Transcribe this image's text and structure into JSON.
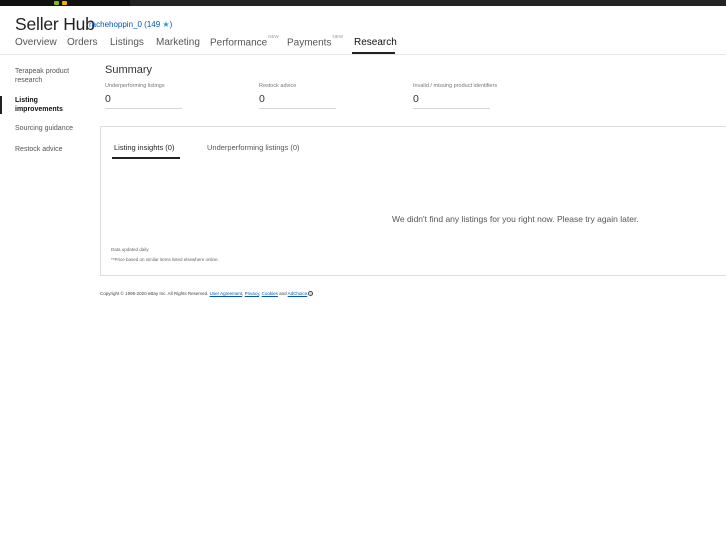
{
  "app": {
    "title": "Seller Hub"
  },
  "user": {
    "name": "rachehoppin_0",
    "score_open": "(149",
    "score_close": ")",
    "star_icon": "star-icon"
  },
  "tabs": [
    {
      "label": "Overview",
      "badge": ""
    },
    {
      "label": "Orders",
      "badge": ""
    },
    {
      "label": "Listings",
      "badge": ""
    },
    {
      "label": "Marketing",
      "badge": ""
    },
    {
      "label": "Performance",
      "badge": "NEW"
    },
    {
      "label": "Payments",
      "badge": "NEW"
    },
    {
      "label": "Research",
      "badge": "",
      "active": true
    }
  ],
  "sidebar": {
    "items": [
      {
        "label": "Terapeak product research"
      },
      {
        "label": "Listing improvements",
        "active": true
      },
      {
        "label": "Sourcing guidance"
      },
      {
        "label": "Restock advice"
      }
    ]
  },
  "summary": {
    "title": "Summary",
    "metrics": [
      {
        "label": "Underperforming listings",
        "value": "0"
      },
      {
        "label": "Restock advice",
        "value": "0"
      },
      {
        "label": "Invalid / missing product identifiers",
        "value": "0"
      }
    ]
  },
  "panel": {
    "tabs": [
      {
        "label": "Listing insights (0)",
        "active": true
      },
      {
        "label": "Underperforming listings (0)"
      }
    ],
    "empty_message": "We didn't find any listings for you right now. Please try again later.",
    "notes": [
      "Data updated daily.",
      "**Price based on similar items listed elsewhere online."
    ]
  },
  "footer": {
    "copyright": "Copyright © 1995-2020 eBay Inc. All Rights Reserved.",
    "links": [
      "User Agreement",
      "Privacy",
      "Cookies"
    ],
    "and_text": "and",
    "adchoice": "AdChoice",
    "info_icon": "i"
  },
  "colors": {
    "link": "#0654ba",
    "star": "#1da1d6",
    "accent_underline": "#222222"
  }
}
